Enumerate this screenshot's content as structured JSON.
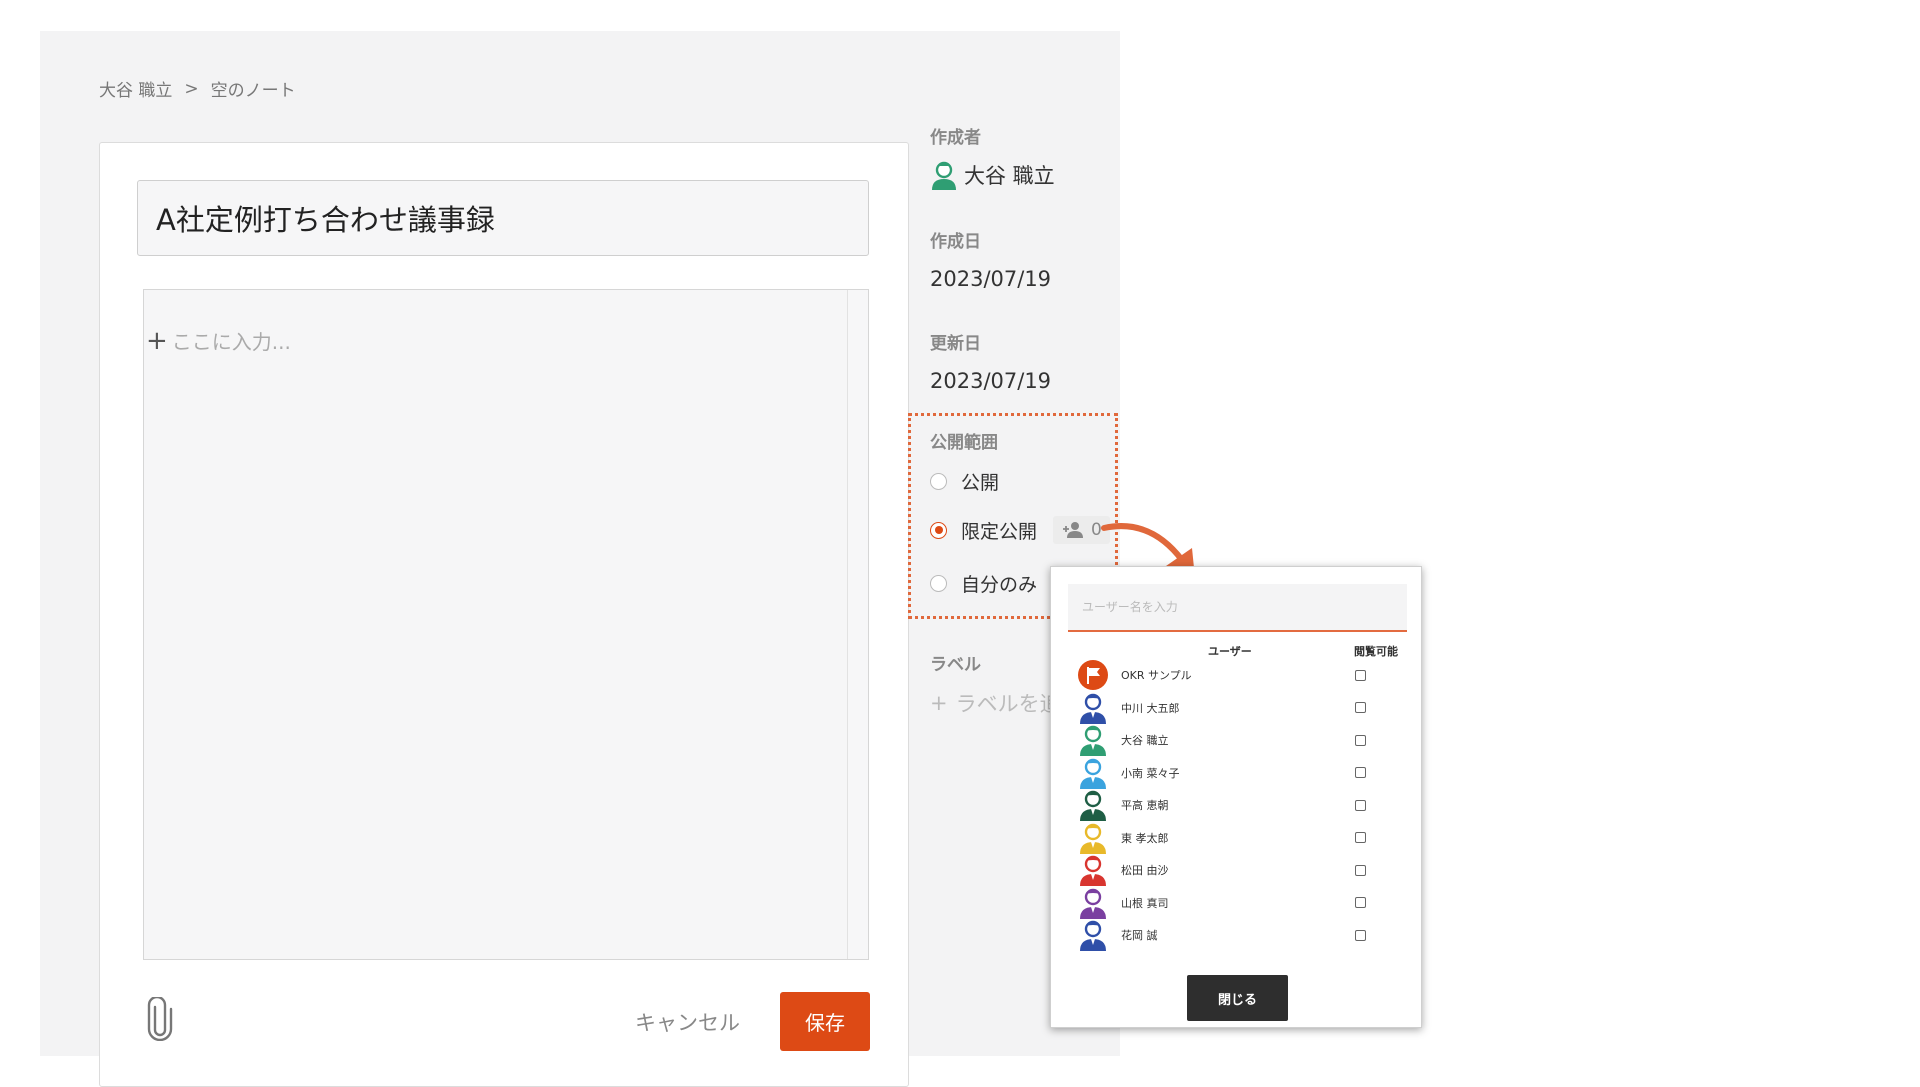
{
  "breadcrumb": {
    "user": "大谷 職立",
    "separator": ">",
    "current": "空のノート"
  },
  "editor": {
    "title_value": "A社定例打ち合わせ議事録",
    "body_placeholder": "ここに入力...",
    "cancel_label": "キャンセル",
    "save_label": "保存"
  },
  "meta": {
    "author_label": "作成者",
    "author_name": "大谷 職立",
    "created_label": "作成日",
    "created_date": "2023/07/19",
    "updated_label": "更新日",
    "updated_date": "2023/07/19"
  },
  "visibility": {
    "label": "公開範囲",
    "options": [
      {
        "label": "公開",
        "checked": false
      },
      {
        "label": "限定公開",
        "checked": true
      },
      {
        "label": "自分のみ",
        "checked": false
      }
    ],
    "member_count": "0"
  },
  "labels": {
    "title": "ラベル",
    "add_text": "ラベルを追"
  },
  "popup": {
    "search_placeholder": "ユーザー名を入力",
    "col_user": "ユーザー",
    "col_access": "閲覧可能",
    "users": [
      {
        "name": "OKR サンプル",
        "color": "#dd4a15",
        "icon": "flag-icon"
      },
      {
        "name": "中川 大五郎",
        "color": "#2f4fa8",
        "icon": "person-icon"
      },
      {
        "name": "大谷 職立",
        "color": "#2f9e73",
        "icon": "person-icon"
      },
      {
        "name": "小南 菜々子",
        "color": "#3aa3de",
        "icon": "person-icon"
      },
      {
        "name": "平高 恵朝",
        "color": "#1f5e45",
        "icon": "person-icon"
      },
      {
        "name": "東 孝太郎",
        "color": "#e8b92a",
        "icon": "person-icon"
      },
      {
        "name": "松田 由沙",
        "color": "#d8352f",
        "icon": "person-icon"
      },
      {
        "name": "山根 真司",
        "color": "#7a3fa0",
        "icon": "person-icon"
      },
      {
        "name": "花岡 誠",
        "color": "#2f4fa8",
        "icon": "person-icon"
      }
    ],
    "close_label": "閉じる"
  },
  "colors": {
    "accent": "#dd4a15",
    "highlight_border": "#e0683b",
    "dark_button": "#2e2e2e"
  }
}
